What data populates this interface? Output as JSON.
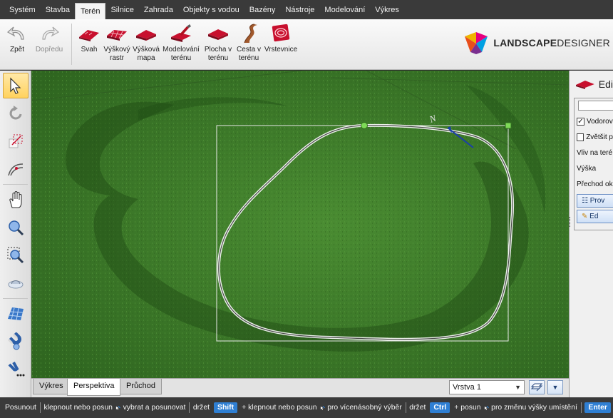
{
  "menu": {
    "items": [
      "Systém",
      "Stavba",
      "Terén",
      "Silnice",
      "Zahrada",
      "Objekty s vodou",
      "Bazény",
      "Nástroje",
      "Modelování",
      "Výkres"
    ],
    "active": "Terén"
  },
  "ribbon": {
    "undo": "Zpět",
    "redo": "Dopředu",
    "tools": [
      {
        "l1": "Svah",
        "l2": "",
        "icon": "slope-icon"
      },
      {
        "l1": "Výškový",
        "l2": "rastr",
        "icon": "height-grid-icon"
      },
      {
        "l1": "Výšková",
        "l2": "mapa",
        "icon": "height-map-icon"
      },
      {
        "l1": "Modelování",
        "l2": "terénu",
        "icon": "terrain-modeling-icon"
      },
      {
        "l1": "Plocha v",
        "l2": "terénu",
        "icon": "terrain-area-icon"
      },
      {
        "l1": "Cesta v",
        "l2": "terénu",
        "icon": "terrain-path-icon"
      },
      {
        "l1": "Vrstevnice",
        "l2": "",
        "icon": "contour-icon"
      }
    ]
  },
  "logo": {
    "bold": "LANDSCAPE",
    "light": "DESIGNER"
  },
  "left_tools": [
    "select-arrow-icon",
    "rotate-icon",
    "resize-icon",
    "curve-edit-icon",
    "pan-hand-icon",
    "zoom-icon",
    "zoom-window-icon",
    "orbit-icon",
    "grid-icon",
    "magnet-icon",
    "more-tools-icon"
  ],
  "viewport": {
    "compass_letter": "N"
  },
  "bottom": {
    "tabs": [
      "Výkres",
      "Perspektiva",
      "Průchod"
    ],
    "active_tab": "Perspektiva",
    "layer": "Vrstva 1"
  },
  "right_panel": {
    "title": "Edi",
    "checkbox1": "Vodorov",
    "checkbox1_checked": true,
    "checkbox2": "Zvětšit p",
    "checkbox2_checked": false,
    "row_influence": "Vliv na teré",
    "row_height": "Výška",
    "row_transition": "Přechod ok",
    "btn1": "Prov",
    "btn2": "Ed"
  },
  "status": {
    "s1": "Posunout",
    "s2": "klepnout nebo posun",
    "s3": "vybrat a posunovat",
    "s4": "držet",
    "key_shift": "Shift",
    "s5": "+ klepnout nebo posun",
    "s6": "pro vícenásobný výběr",
    "s7": "držet",
    "key_ctrl": "Ctrl",
    "s8": "+ posun",
    "s9": "pro změnu výšky umístění",
    "key_enter": "Enter"
  },
  "colors": {
    "accent_red": "#c8102e",
    "key_blue": "#2f7fd3",
    "grass": "#3f7d2a",
    "selection_handle": "#7ed957"
  }
}
